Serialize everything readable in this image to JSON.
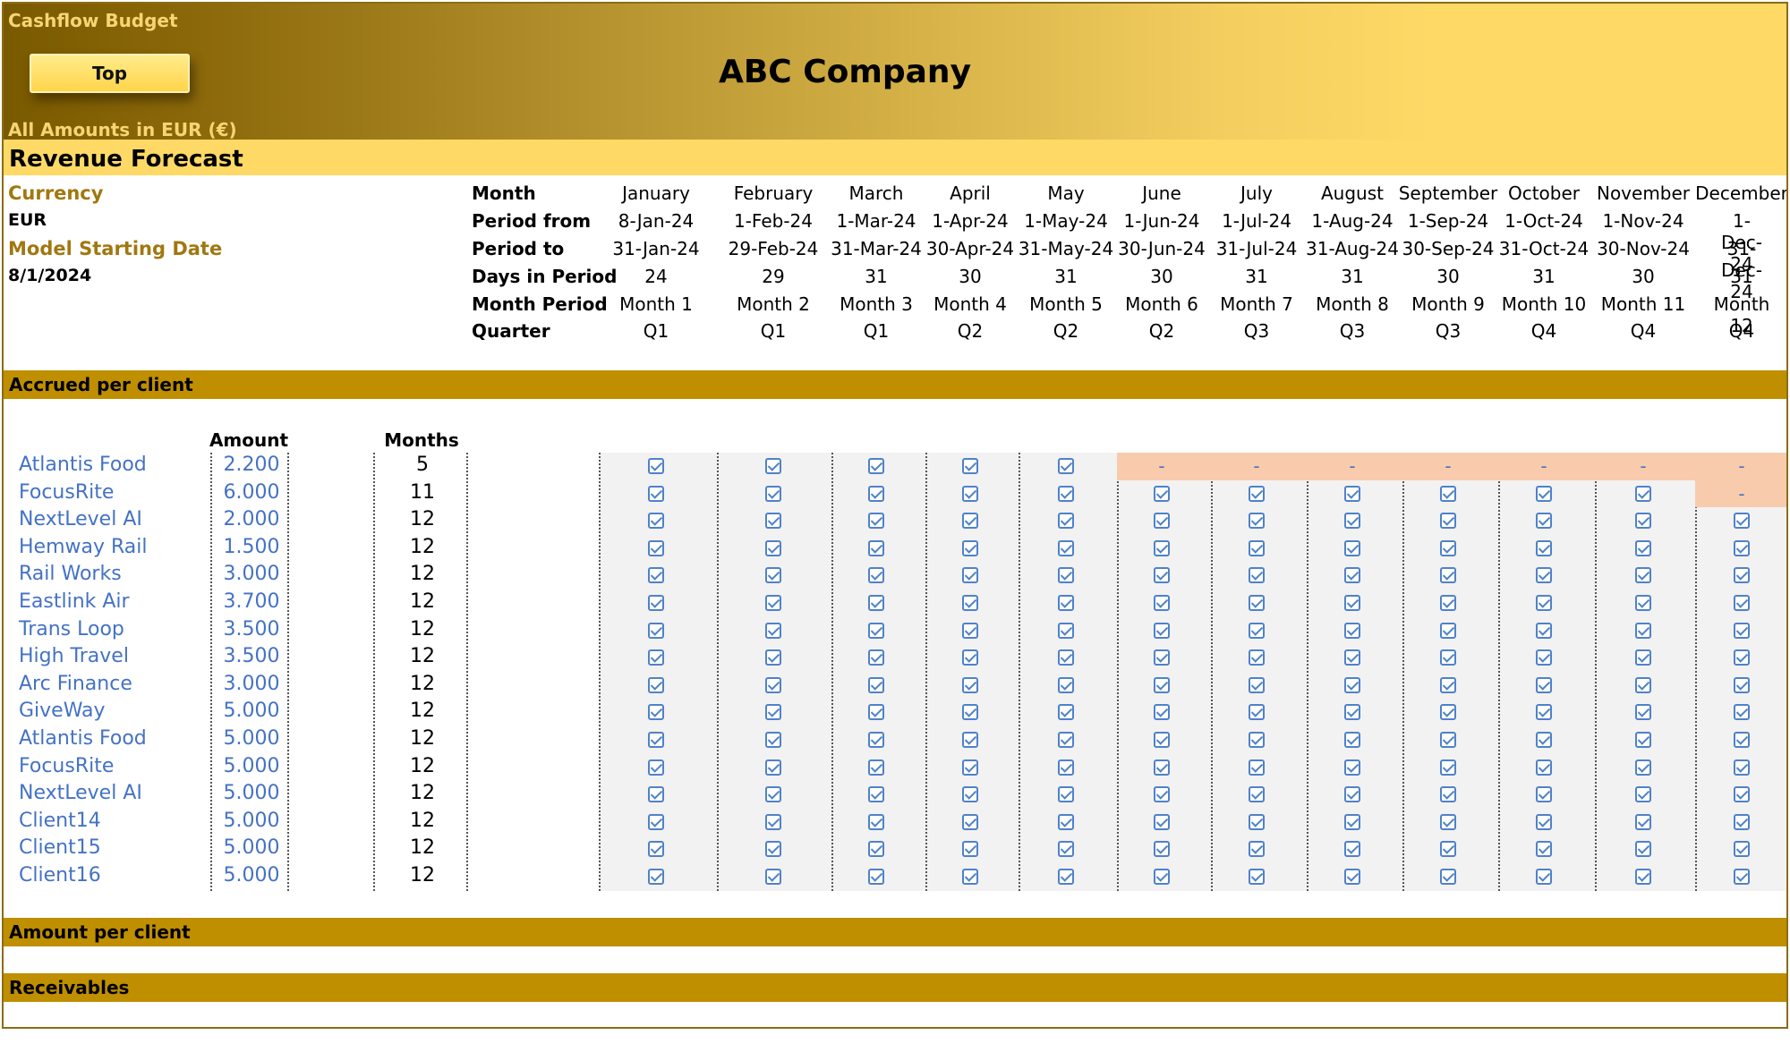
{
  "header": {
    "app_title": "Cashflow Budget",
    "top_button": "Top",
    "company": "ABC Company",
    "amounts_note": "All Amounts in  EUR (€)"
  },
  "section_title": "Revenue Forecast",
  "info": {
    "currency_label": "Currency",
    "currency_value": "EUR",
    "start_label": "Model Starting Date",
    "start_value": "8/1/2024"
  },
  "row_labels": [
    "Month",
    "Period from",
    "Period to",
    "Days in Period",
    "Month Period",
    "Quarter"
  ],
  "months": [
    {
      "name": "January",
      "from": "8-Jan-24",
      "to": "31-Jan-24",
      "days": "24",
      "period": "Month 1",
      "quarter": "Q1"
    },
    {
      "name": "February",
      "from": "1-Feb-24",
      "to": "29-Feb-24",
      "days": "29",
      "period": "Month 2",
      "quarter": "Q1"
    },
    {
      "name": "March",
      "from": "1-Mar-24",
      "to": "31-Mar-24",
      "days": "31",
      "period": "Month 3",
      "quarter": "Q1"
    },
    {
      "name": "April",
      "from": "1-Apr-24",
      "to": "30-Apr-24",
      "days": "30",
      "period": "Month 4",
      "quarter": "Q2"
    },
    {
      "name": "May",
      "from": "1-May-24",
      "to": "31-May-24",
      "days": "31",
      "period": "Month 5",
      "quarter": "Q2"
    },
    {
      "name": "June",
      "from": "1-Jun-24",
      "to": "30-Jun-24",
      "days": "30",
      "period": "Month 6",
      "quarter": "Q2"
    },
    {
      "name": "July",
      "from": "1-Jul-24",
      "to": "31-Jul-24",
      "days": "31",
      "period": "Month 7",
      "quarter": "Q3"
    },
    {
      "name": "August",
      "from": "1-Aug-24",
      "to": "31-Aug-24",
      "days": "31",
      "period": "Month 8",
      "quarter": "Q3"
    },
    {
      "name": "September",
      "from": "1-Sep-24",
      "to": "30-Sep-24",
      "days": "30",
      "period": "Month 9",
      "quarter": "Q3"
    },
    {
      "name": "October",
      "from": "1-Oct-24",
      "to": "31-Oct-24",
      "days": "31",
      "period": "Month 10",
      "quarter": "Q4"
    },
    {
      "name": "November",
      "from": "1-Nov-24",
      "to": "30-Nov-24",
      "days": "30",
      "period": "Month 11",
      "quarter": "Q4"
    },
    {
      "name": "December",
      "from": "1-Dec-24",
      "to": "31-Dec-24",
      "days": "31",
      "period": "Month 12",
      "quarter": "Q4"
    }
  ],
  "bands": {
    "accrued": "Accrued per client",
    "amount_per_client": "Amount per client",
    "receivables": "Receivables"
  },
  "table_headers": {
    "amount": "Amount",
    "months": "Months"
  },
  "inactive_marker": "-",
  "clients": [
    {
      "name": "Atlantis Food",
      "amount": "2.200",
      "months": "5"
    },
    {
      "name": "FocusRite",
      "amount": "6.000",
      "months": "11"
    },
    {
      "name": "NextLevel AI",
      "amount": "2.000",
      "months": "12"
    },
    {
      "name": "Hemway Rail",
      "amount": "1.500",
      "months": "12"
    },
    {
      "name": "Rail Works",
      "amount": "3.000",
      "months": "12"
    },
    {
      "name": "Eastlink Air",
      "amount": "3.700",
      "months": "12"
    },
    {
      "name": "Trans Loop",
      "amount": "3.500",
      "months": "12"
    },
    {
      "name": "High Travel",
      "amount": "3.500",
      "months": "12"
    },
    {
      "name": "Arc Finance",
      "amount": "3.000",
      "months": "12"
    },
    {
      "name": "GiveWay",
      "amount": "5.000",
      "months": "12"
    },
    {
      "name": "Atlantis Food",
      "amount": "5.000",
      "months": "12"
    },
    {
      "name": "FocusRite",
      "amount": "5.000",
      "months": "12"
    },
    {
      "name": "NextLevel AI",
      "amount": "5.000",
      "months": "12"
    },
    {
      "name": "Client14",
      "amount": "5.000",
      "months": "12"
    },
    {
      "name": "Client15",
      "amount": "5.000",
      "months": "12"
    },
    {
      "name": "Client16",
      "amount": "5.000",
      "months": "12"
    }
  ],
  "colors": {
    "accent_gold": "#bf8f00",
    "header_yellow": "#ffd966",
    "link_blue": "#4472c4",
    "inactive_pink": "#f8cbad"
  }
}
